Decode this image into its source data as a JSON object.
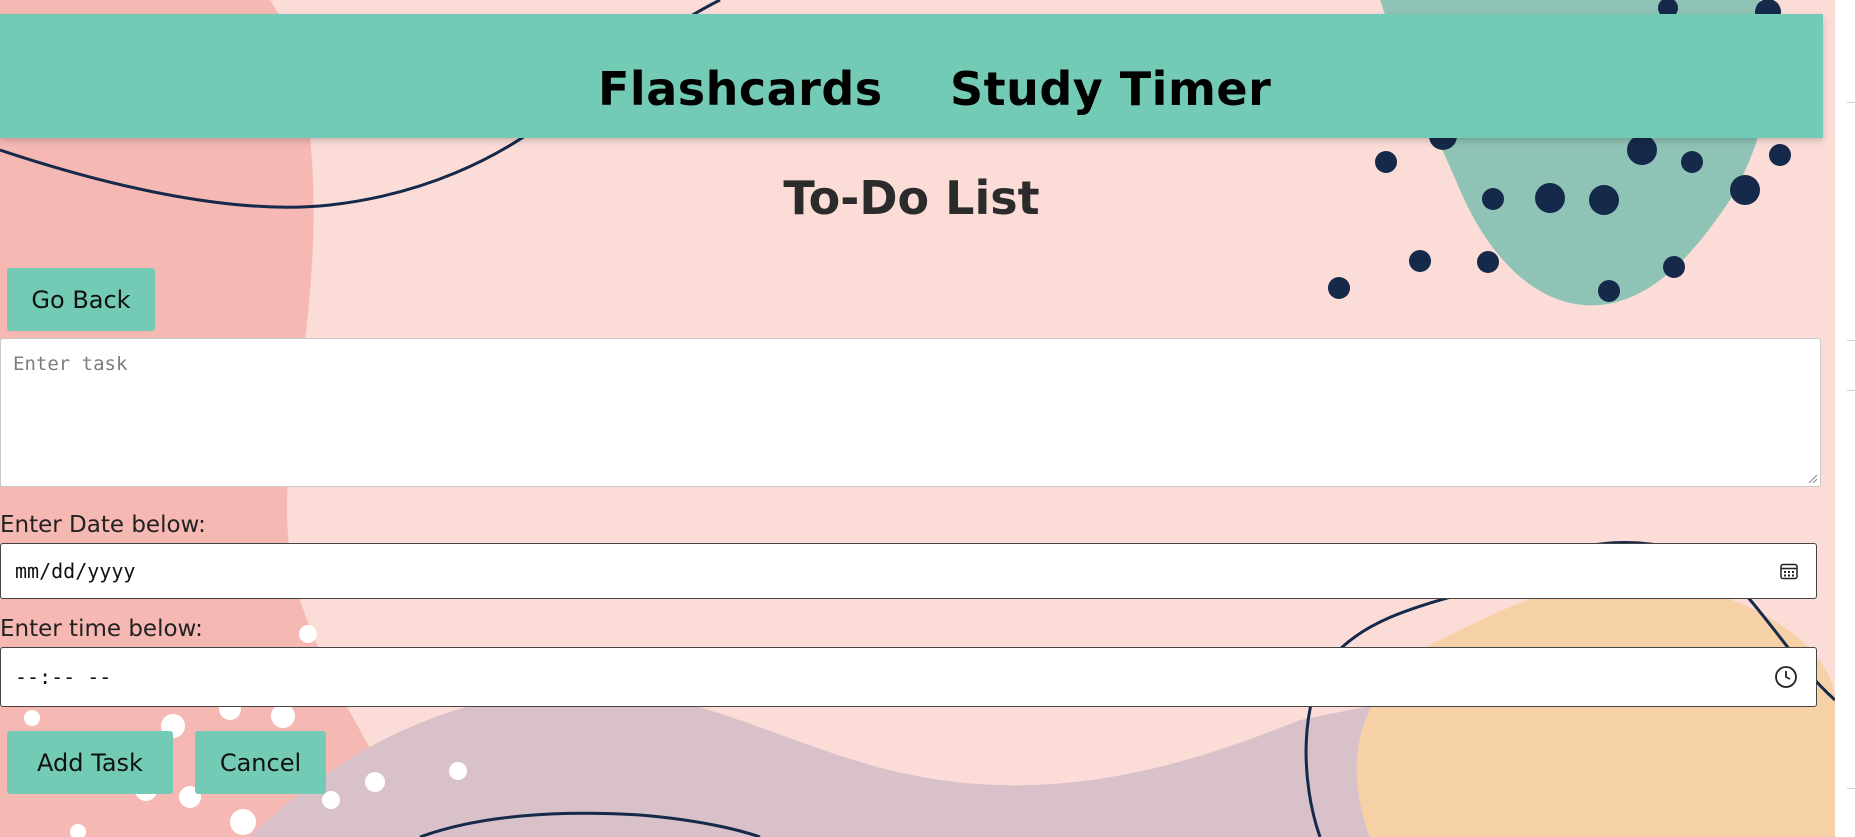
{
  "nav": {
    "links": [
      "Flashcards",
      "Study Timer"
    ]
  },
  "title": "To-Do List",
  "buttons": {
    "back": "Go Back",
    "add": "Add Task",
    "cancel": "Cancel"
  },
  "task": {
    "placeholder": "Enter task"
  },
  "date": {
    "label": "Enter Date below:",
    "value": "mm/dd/yyyy",
    "icon": "calendar-icon"
  },
  "time": {
    "label": "Enter time below:",
    "value": "--:-- --",
    "icon": "clock-icon"
  },
  "colors": {
    "background": "#fbdcd7",
    "accent": "#73cbb6",
    "blob_pink": "#f5b8b3",
    "blob_mauve": "#d8c1c9",
    "blob_peach": "#f7d1a6",
    "dots_navy": "#15294a"
  }
}
